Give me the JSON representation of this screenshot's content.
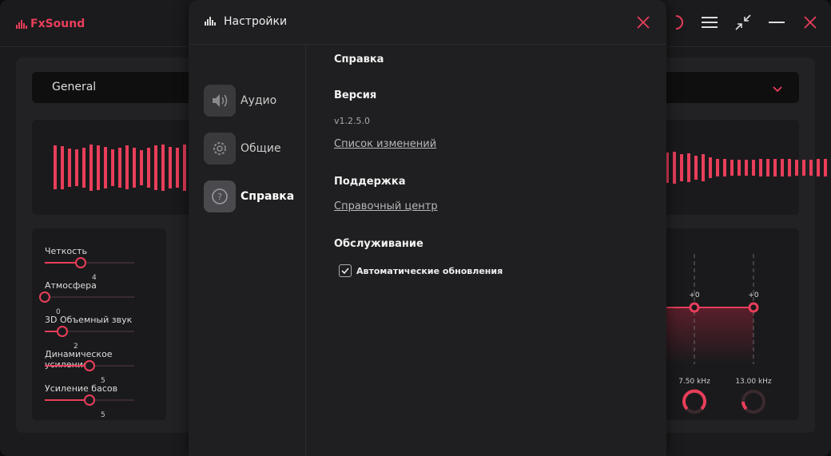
{
  "app": {
    "logo_text": "FxSound",
    "brand_color": "#e93e5a",
    "top_icons": [
      "power-icon",
      "menu-icon",
      "minimize-to-compact-icon",
      "minimize-icon",
      "close-icon"
    ]
  },
  "preset": {
    "selected": "General"
  },
  "effects": [
    {
      "label": "Четкость",
      "value": "4",
      "level": 0.4
    },
    {
      "label": "Атмосфера",
      "value": "0",
      "level": 0
    },
    {
      "label": "3D Объемный звук",
      "value": "2",
      "level": 0.2
    },
    {
      "label": "Динамическое усиление",
      "value": "5",
      "level": 0.5
    },
    {
      "label": "Усиление басов",
      "value": "5",
      "level": 0.5
    }
  ],
  "eq": {
    "bands": [
      {
        "gain": "+0",
        "freq": "7.50 kHz"
      },
      {
        "gain": "+0",
        "freq": "13.00 kHz"
      }
    ]
  },
  "settings": {
    "title": "Настройки",
    "nav": [
      {
        "label": "Аудио",
        "icon": "speaker-icon",
        "active": false
      },
      {
        "label": "Общие",
        "icon": "gear-icon",
        "active": false
      },
      {
        "label": "Справка",
        "icon": "help-icon",
        "active": true
      }
    ],
    "help": {
      "heading": "Справка",
      "version_heading": "Версия",
      "version": "v1.2.5.0",
      "changelog_link": "Список изменений",
      "support_heading": "Поддержка",
      "help_center_link": "Справочный центр",
      "maintenance_heading": "Обслуживание",
      "auto_updates_label": "Автоматические обновления",
      "auto_updates_checked": true
    }
  }
}
